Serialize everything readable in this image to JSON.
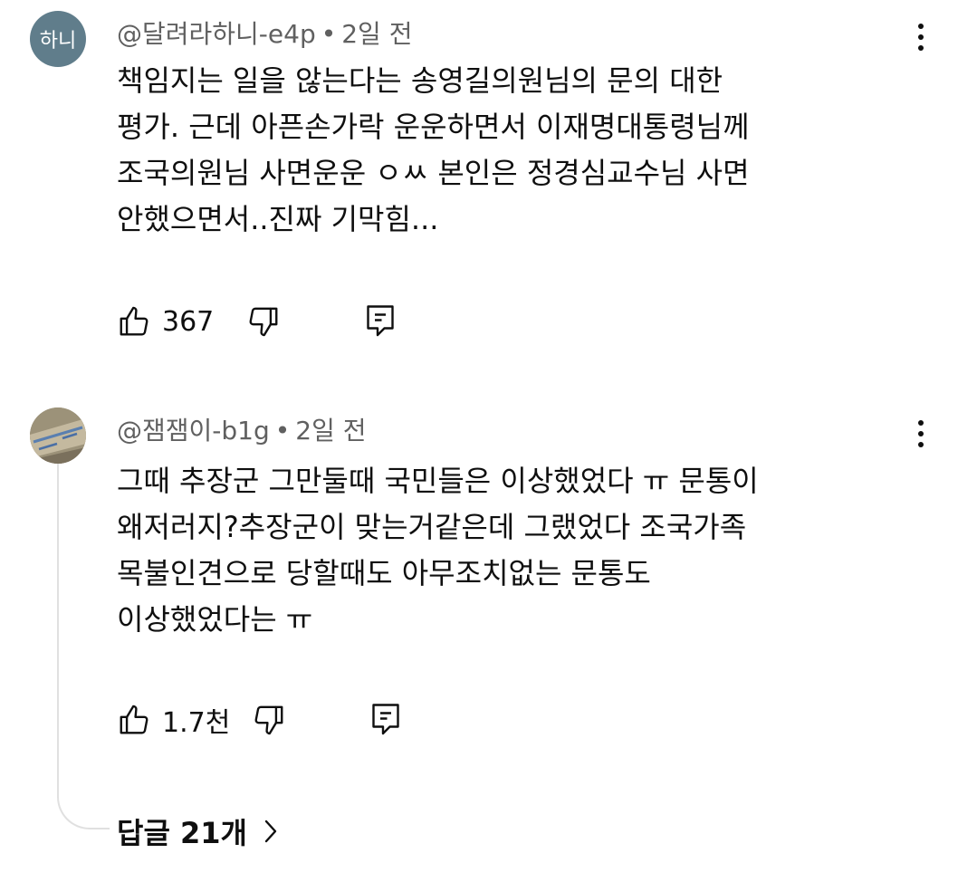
{
  "comments": [
    {
      "avatar_text": "하니",
      "author": "@달려라하니-e4p",
      "separator": "•",
      "time": "2일 전",
      "lines": [
        "책임지는 일을 않는다는 송영길의원님의 문의 대한",
        "평가. 근데 아픈손가락 운운하면서  이재명대통령님께",
        "조국의원님 사면운운 ㅇㅆ 본인은 정경심교수님 사면",
        "안했으면서..진짜 기막힘..."
      ],
      "likes": "367"
    },
    {
      "avatar_text": "",
      "author": "@잼잼이-b1g",
      "separator": "•",
      "time": "2일 전",
      "lines": [
        "그때 추장군 그만둘때  국민들은 이상했었다  ㅠ 문통이",
        "왜저러지?추장군이 맞는거같은데  그랬었다  조국가족",
        "목불인견으로 당할때도  아무조치없는 문통도",
        "이상했었다는 ㅠ"
      ],
      "likes": "1.7천"
    }
  ],
  "replies_label": "답글 21개",
  "colors": {
    "avatar_bg": "#607d8b",
    "meta_text": "#606060",
    "thread_line": "#e0e0e0"
  },
  "icons": [
    "like-icon",
    "dislike-icon",
    "reply-icon",
    "more-vert-icon",
    "chevron-right-icon"
  ]
}
